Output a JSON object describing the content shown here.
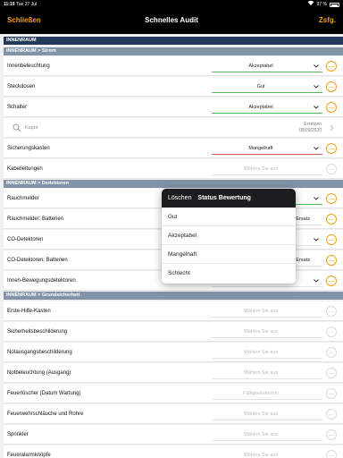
{
  "status_bar": {
    "time": "11:19",
    "date": "Tue 27 Jul",
    "battery": "97 %"
  },
  "nav": {
    "left_label": "Schließen",
    "title": "Schnelles Audit",
    "right_label": "Zsfg."
  },
  "colors": {
    "accent": "#f2a01a",
    "section": "#25395b",
    "subsection": "#8193a6",
    "ok_line": "#5cb85c",
    "bad_line": "#d9534f"
  },
  "placeholder": "Wählen Sie aus",
  "sections": {
    "main": "INNENRAUM",
    "strom": "INNENRAUM > Strom",
    "detektoren": "INNENRAUM > Dedektoren",
    "grund": "INNENRAUM > Grundsicherheit"
  },
  "rows": [
    {
      "label": "Innenbeleuchtung",
      "value": "Akzeptabel"
    },
    {
      "label": "Steckdosen",
      "value": "Gut"
    },
    {
      "label": "Schalter",
      "value": "Akzeptabel"
    },
    {
      "label": "Sicherungskasten",
      "value": "Mangelhaft"
    },
    {
      "label": "Kabelleitungen",
      "value": "Wählen Sie aus"
    },
    {
      "label": "Rauchmelder",
      "value": ""
    },
    {
      "label": "Rauchmelder: Batterien",
      "value": "Ersatz"
    },
    {
      "label": "CO-Detektoren",
      "value": ""
    },
    {
      "label": "CO-Detektoren: Batterien",
      "value": "Ersatz"
    },
    {
      "label": "Innen-Bewegungsdetektoren",
      "value": ""
    },
    {
      "label": "Erste-Hilfe-Kasten",
      "value": "Wählen Sie aus"
    },
    {
      "label": "Sicherheitsbeschilderung",
      "value": "Wählen Sie aus"
    },
    {
      "label": "Notausgangsbeschilderung",
      "value": "Wählen Sie aus"
    },
    {
      "label": "Notbeleuchtung (Ausgang)",
      "value": "Wählen Sie aus"
    },
    {
      "label": "Feuerlöscher (Datum Wartung)",
      "value": "Fälligkeitstermin"
    },
    {
      "label": "Feuerwehrschläuche und Rohre",
      "value": "Wählen Sie aus"
    },
    {
      "label": "Sprinkler",
      "value": "Wählen Sie aus"
    },
    {
      "label": "Feueralarmknöpfe",
      "value": "Wählen Sie aus"
    }
  ],
  "defect": {
    "label": "Kaput",
    "action": "Ersetzen",
    "date": "09/09/2020"
  },
  "popup": {
    "delete_label": "Löschen",
    "title": "Status Bewertung",
    "options": [
      "Gut",
      "Akzeptabel",
      "Mangelhaft",
      "Schlecht"
    ]
  }
}
